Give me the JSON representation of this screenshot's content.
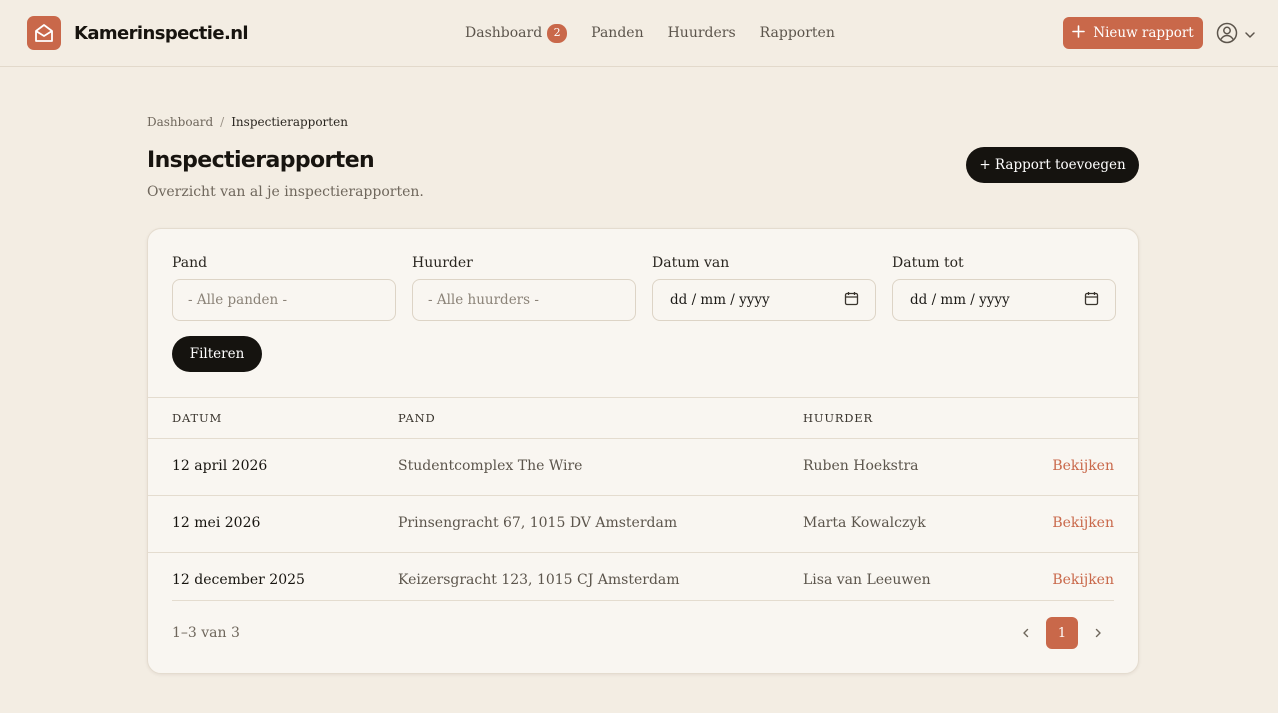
{
  "brand": {
    "name": "Kamerinspectie.nl",
    "icon": "envelope-house-icon"
  },
  "colors": {
    "accent": "#c9684a",
    "dark": "#15130f",
    "background": "#f3ede3",
    "card": "#f9f6f1"
  },
  "nav": {
    "items": [
      {
        "label": "Dashboard",
        "badge": "2"
      },
      {
        "label": "Panden"
      },
      {
        "label": "Huurders"
      },
      {
        "label": "Rapporten"
      }
    ]
  },
  "header_actions": {
    "new_report_label": "Nieuw rapport",
    "new_report_icon": "plus-icon",
    "user_icon": "user-circle-icon",
    "user_chevron": "chevron-down-icon"
  },
  "breadcrumb": {
    "parent": "Dashboard",
    "separator": "/",
    "current": "Inspectierapporten"
  },
  "page": {
    "title": "Inspectierapporten",
    "subtitle": "Overzicht van al je inspectierapporten.",
    "add_button_label": "+ Rapport toevoegen"
  },
  "filters": {
    "pand": {
      "label": "Pand",
      "value": "- Alle panden -"
    },
    "huurder": {
      "label": "Huurder",
      "value": "- Alle huurders -"
    },
    "datum_van": {
      "label": "Datum van",
      "value": "dd / mm / yyyy",
      "icon": "calendar-icon"
    },
    "datum_tot": {
      "label": "Datum tot",
      "value": "dd / mm / yyyy",
      "icon": "calendar-icon"
    },
    "submit_label": "Filteren"
  },
  "table": {
    "columns": [
      "Datum",
      "Pand",
      "Huurder"
    ],
    "rows": [
      {
        "datum": "12 april 2026",
        "pand": "Studentcomplex The Wire",
        "huurder": "Ruben Hoekstra",
        "action": "Bekijken"
      },
      {
        "datum": "12 mei 2026",
        "pand": "Prinsengracht 67, 1015 DV Amsterdam",
        "huurder": "Marta Kowalczyk",
        "action": "Bekijken"
      },
      {
        "datum": "12 december 2025",
        "pand": "Keizersgracht 123, 1015 CJ Amsterdam",
        "huurder": "Lisa van Leeuwen",
        "action": "Bekijken"
      }
    ]
  },
  "pagination": {
    "summary": "1–3 van 3",
    "current_page": "1",
    "prev_icon": "chevron-left-icon",
    "next_icon": "chevron-right-icon"
  }
}
